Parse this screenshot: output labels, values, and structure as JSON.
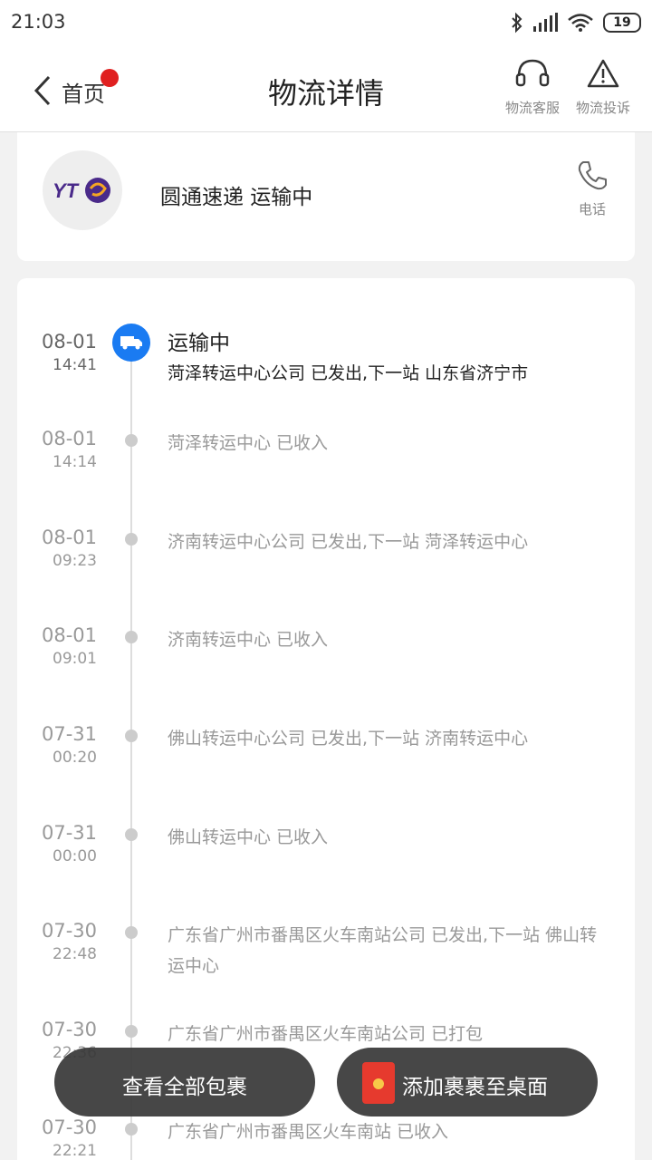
{
  "status_bar": {
    "time": "21:03",
    "battery": "19"
  },
  "navbar": {
    "back_label": "首页",
    "title": "物流详情",
    "service_label": "物流客服",
    "complaint_label": "物流投诉"
  },
  "carrier": {
    "logo_text": "YT",
    "name_status": "圆通速递  运输中",
    "phone_label": "电话"
  },
  "timeline": {
    "current": {
      "date": "08-01",
      "time": "14:41",
      "status": "运输中",
      "text": "菏泽转运中心公司 已发出,下一站 山东省济宁市"
    },
    "entries": [
      {
        "date": "08-01",
        "time": "14:14",
        "text": "菏泽转运中心 已收入"
      },
      {
        "date": "08-01",
        "time": "09:23",
        "text": "济南转运中心公司 已发出,下一站 菏泽转运中心"
      },
      {
        "date": "08-01",
        "time": "09:01",
        "text": "济南转运中心 已收入"
      },
      {
        "date": "07-31",
        "time": "00:20",
        "text": "佛山转运中心公司 已发出,下一站 济南转运中心"
      },
      {
        "date": "07-31",
        "time": "00:00",
        "text": "佛山转运中心 已收入"
      },
      {
        "date": "07-30",
        "time": "22:48",
        "text": "广东省广州市番禺区火车南站公司 已发出,下一站 佛山转运中心"
      },
      {
        "date": "07-30",
        "time": "22:36",
        "text": "广东省广州市番禺区火车南站公司 已打包"
      },
      {
        "date": "07-30",
        "time": "22:21",
        "text": "广东省广州市番禺区火车南站 已收入"
      }
    ]
  },
  "actions": {
    "view_all": "查看全部包裹",
    "add_to_desktop": "添加裹裹至桌面"
  },
  "colors": {
    "accent": "#1a7bf2",
    "badge": "#e02020",
    "logo_purple": "#4a2a8a"
  }
}
